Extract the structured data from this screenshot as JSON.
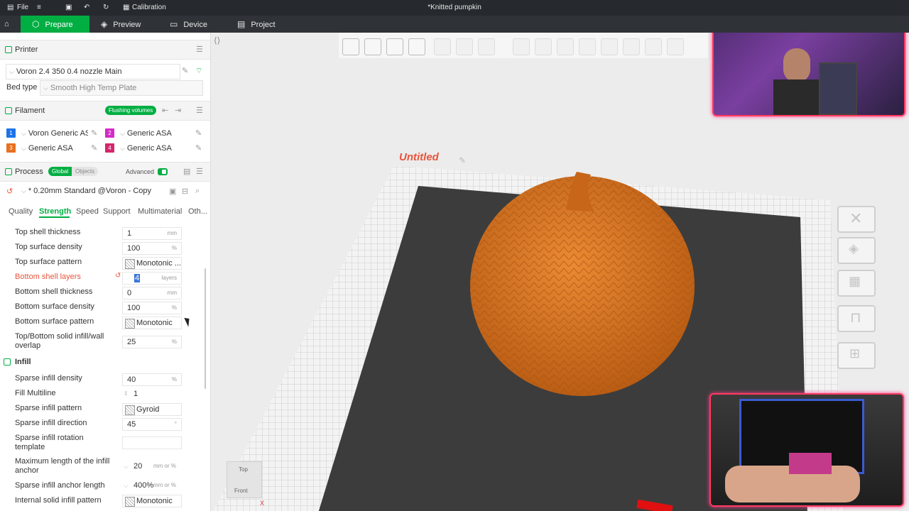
{
  "titlebar": {
    "file_label": "File",
    "calibration_label": "Calibration",
    "document_title": "*Knitted pumpkin"
  },
  "nav": {
    "tabs": [
      {
        "label": "Prepare",
        "icon": "cube-icon",
        "active": true
      },
      {
        "label": "Preview",
        "icon": "layers-icon",
        "active": false
      },
      {
        "label": "Device",
        "icon": "monitor-icon",
        "active": false
      },
      {
        "label": "Project",
        "icon": "document-icon",
        "active": false
      }
    ]
  },
  "printer": {
    "section_title": "Printer",
    "selected": "Voron 2.4 350 0.4 nozzle Main",
    "bed_type_label": "Bed type",
    "bed_type": "Smooth High Temp Plate"
  },
  "filament": {
    "section_title": "Filament",
    "flushing_label": "Flushing volumes",
    "slots": [
      {
        "num": "1",
        "name": "Voron Generic AS...",
        "color": "#1e73e8"
      },
      {
        "num": "2",
        "name": "Generic ASA",
        "color": "#d42ac8"
      },
      {
        "num": "3",
        "name": "Generic ASA",
        "color": "#e8701e"
      },
      {
        "num": "4",
        "name": "Generic ASA",
        "color": "#d4266e"
      }
    ]
  },
  "process": {
    "section_title": "Process",
    "global_label": "Global",
    "objects_label": "Objects",
    "advanced_label": "Advanced",
    "preset": "* 0.20mm Standard @Voron - Copy",
    "tabs": [
      "Quality",
      "Strength",
      "Speed",
      "Support",
      "Multimaterial",
      "Oth..."
    ],
    "active_tab": "Strength"
  },
  "settings": {
    "top_shell_thickness": {
      "label": "Top shell thickness",
      "value": "1",
      "unit": "mm"
    },
    "top_surface_density": {
      "label": "Top surface density",
      "value": "100",
      "unit": "%"
    },
    "top_surface_pattern": {
      "label": "Top surface pattern",
      "value": "Monotonic ..."
    },
    "bottom_shell_layers": {
      "label": "Bottom shell layers",
      "value": "4",
      "unit": "layers"
    },
    "bottom_shell_thickness": {
      "label": "Bottom shell thickness",
      "value": "0",
      "unit": "mm"
    },
    "bottom_surface_density": {
      "label": "Bottom surface density",
      "value": "100",
      "unit": "%"
    },
    "bottom_surface_pattern": {
      "label": "Bottom surface pattern",
      "value": "Monotonic"
    },
    "overlap": {
      "label_line1": "Top/Bottom solid infill/wall",
      "label_line2": "overlap",
      "value": "25",
      "unit": "%"
    },
    "infill_section": "Infill",
    "sparse_infill_density": {
      "label": "Sparse infill density",
      "value": "40",
      "unit": "%"
    },
    "fill_multiline": {
      "label": "Fill Multiline",
      "value": "1"
    },
    "sparse_infill_pattern": {
      "label": "Sparse infill pattern",
      "value": "Gyroid"
    },
    "sparse_infill_direction": {
      "label": "Sparse infill direction",
      "value": "45",
      "unit": "°"
    },
    "rotation_template": {
      "label_line1": "Sparse infill rotation",
      "label_line2": "template",
      "value": ""
    },
    "max_anchor": {
      "label_line1": "Maximum length of the infill",
      "label_line2": "anchor",
      "value": "20",
      "unit": "mm or %"
    },
    "anchor_length": {
      "label": "Sparse infill anchor length",
      "value": "400%",
      "unit": "mm or %"
    },
    "internal_solid_pattern": {
      "label": "Internal solid infill pattern",
      "value": "Monotonic"
    }
  },
  "viewport": {
    "plate_name": "Untitled",
    "view_cube_top": "Top",
    "view_cube_front": "Front",
    "axis_x": "X",
    "model_color": "#d9701e",
    "plate_color": "#3c3c3c"
  }
}
